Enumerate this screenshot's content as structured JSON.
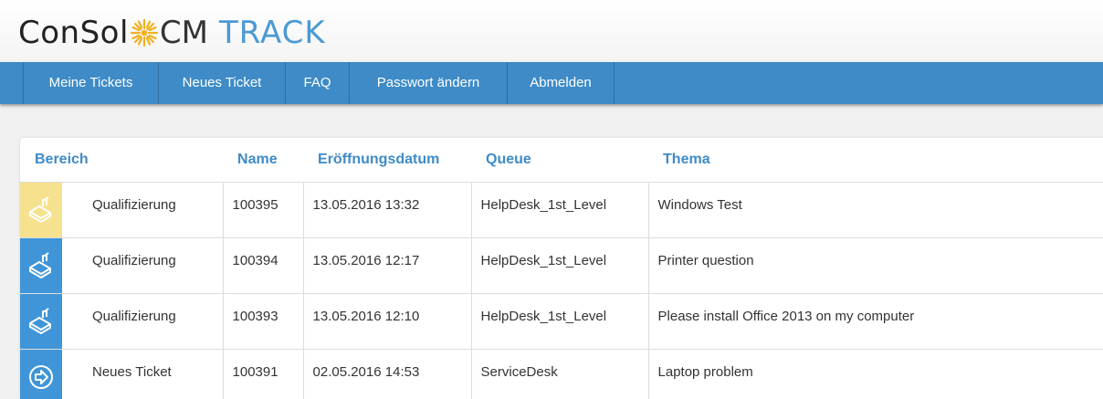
{
  "app": {
    "brand": "ConSol",
    "product": "CM",
    "product_suffix": "TRACK"
  },
  "nav": [
    {
      "label": "Meine Tickets"
    },
    {
      "label": "Neues Ticket"
    },
    {
      "label": "FAQ"
    },
    {
      "label": "Passwort ändern"
    },
    {
      "label": "Abmelden"
    }
  ],
  "table": {
    "columns": [
      "Bereich",
      "Name",
      "Eröffnungsdatum",
      "Queue",
      "Thema"
    ],
    "rows": [
      {
        "icon": "ticket-edit-icon",
        "icon_color": "#f6e28e",
        "bereich": "Qualifizierung",
        "name": "100395",
        "datum": "13.05.2016 13:32",
        "queue": "HelpDesk_1st_Level",
        "thema": "Windows Test"
      },
      {
        "icon": "ticket-edit-icon",
        "icon_color": "#3f95d8",
        "bereich": "Qualifizierung",
        "name": "100394",
        "datum": "13.05.2016 12:17",
        "queue": "HelpDesk_1st_Level",
        "thema": "Printer question"
      },
      {
        "icon": "ticket-edit-icon",
        "icon_color": "#3f95d8",
        "bereich": "Qualifizierung",
        "name": "100393",
        "datum": "13.05.2016 12:10",
        "queue": "HelpDesk_1st_Level",
        "thema": "Please install Office 2013 on my computer"
      },
      {
        "icon": "arrow-circle-icon",
        "icon_color": "#3f95d8",
        "bereich": "Neues Ticket",
        "name": "100391",
        "datum": "02.05.2016 14:53",
        "queue": "ServiceDesk",
        "thema": "Laptop problem"
      }
    ]
  },
  "colors": {
    "accent": "#3e8bc7",
    "nav_bg": "#3e8bc7",
    "yellow_status": "#f6e28e",
    "blue_status": "#3f95d8"
  }
}
